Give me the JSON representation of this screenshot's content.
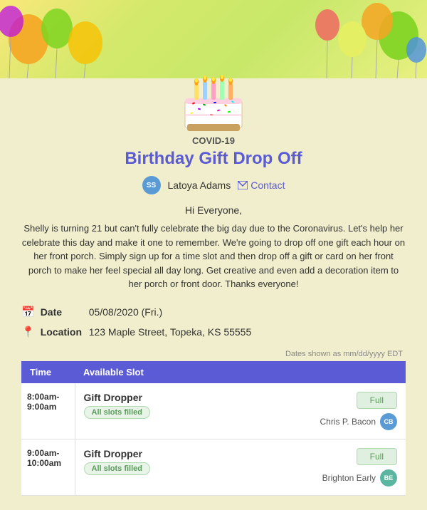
{
  "banner": {
    "alt": "Birthday balloons banner"
  },
  "event": {
    "covid_label": "COVID-19",
    "title": "Birthday Gift Drop Off",
    "organizer": {
      "initials": "SS",
      "name": "Latoya Adams",
      "contact_label": "Contact"
    },
    "greeting": "Hi Everyone,",
    "description": "Shelly is turning 21 but can't fully celebrate the big day due to the Coronavirus. Let's help her celebrate this day and make it one to remember. We're going to drop off one gift each hour on her front porch. Simply sign up for a time slot and then drop off a gift or card on her front porch to make her feel special all day long. Get creative and even add a decoration item to her porch or front door. Thanks everyone!",
    "date_label": "Date",
    "date_value": "05/08/2020 (Fri.)",
    "location_label": "Location",
    "location_value": "123 Maple Street, Topeka, KS 55555",
    "timezone_note": "Dates shown as mm/dd/yyyy EDT",
    "table": {
      "col_time": "Time",
      "col_slot": "Available Slot",
      "rows": [
        {
          "time": "8:00am-9:00am",
          "slot_title": "Gift Dropper",
          "badge": "All slots filled",
          "status": "Full",
          "assignee_name": "Chris P. Bacon",
          "assignee_initials": "CB",
          "avatar_type": "cb"
        },
        {
          "time": "9:00am-10:00am",
          "slot_title": "Gift Dropper",
          "badge": "All slots filled",
          "status": "Full",
          "assignee_name": "Brighton Early",
          "assignee_initials": "BE",
          "avatar_type": "be"
        }
      ]
    }
  }
}
